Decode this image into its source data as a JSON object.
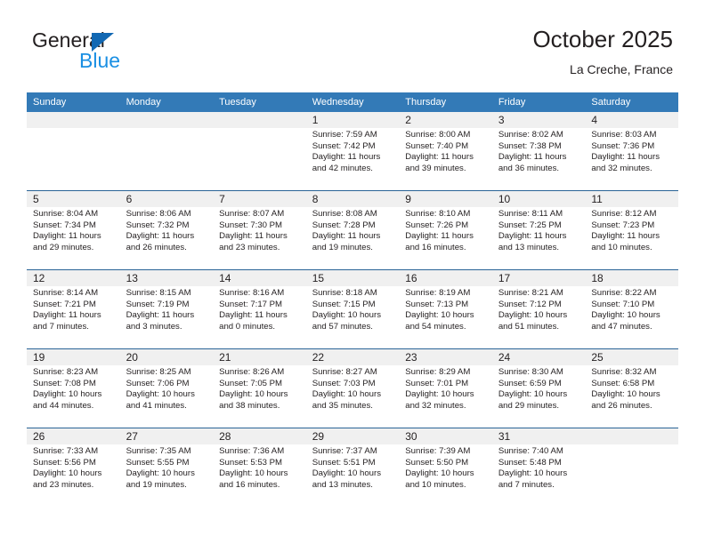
{
  "brand": {
    "name_top": "General",
    "name_bottom": "Blue",
    "accent_color": "#1268b3",
    "blue_text_color": "#1a8fe3"
  },
  "header": {
    "title": "October 2025",
    "subtitle": "La Creche, France"
  },
  "theme": {
    "header_blue": "#337ab7",
    "row_divider_blue": "#2a6496",
    "daynum_band_gray": "#f0f0f0",
    "text_color": "#231f20"
  },
  "weekday_headers": [
    "Sunday",
    "Monday",
    "Tuesday",
    "Wednesday",
    "Thursday",
    "Friday",
    "Saturday"
  ],
  "labels": {
    "sunrise_prefix": "Sunrise:",
    "sunset_prefix": "Sunset:",
    "daylight_prefix": "Daylight:"
  },
  "weeks": [
    [
      {
        "day": "",
        "sunrise": "",
        "sunset": "",
        "daylight_line1": "",
        "daylight_line2": ""
      },
      {
        "day": "",
        "sunrise": "",
        "sunset": "",
        "daylight_line1": "",
        "daylight_line2": ""
      },
      {
        "day": "",
        "sunrise": "",
        "sunset": "",
        "daylight_line1": "",
        "daylight_line2": ""
      },
      {
        "day": "1",
        "sunrise": "Sunrise: 7:59 AM",
        "sunset": "Sunset: 7:42 PM",
        "daylight_line1": "Daylight: 11 hours",
        "daylight_line2": "and 42 minutes."
      },
      {
        "day": "2",
        "sunrise": "Sunrise: 8:00 AM",
        "sunset": "Sunset: 7:40 PM",
        "daylight_line1": "Daylight: 11 hours",
        "daylight_line2": "and 39 minutes."
      },
      {
        "day": "3",
        "sunrise": "Sunrise: 8:02 AM",
        "sunset": "Sunset: 7:38 PM",
        "daylight_line1": "Daylight: 11 hours",
        "daylight_line2": "and 36 minutes."
      },
      {
        "day": "4",
        "sunrise": "Sunrise: 8:03 AM",
        "sunset": "Sunset: 7:36 PM",
        "daylight_line1": "Daylight: 11 hours",
        "daylight_line2": "and 32 minutes."
      }
    ],
    [
      {
        "day": "5",
        "sunrise": "Sunrise: 8:04 AM",
        "sunset": "Sunset: 7:34 PM",
        "daylight_line1": "Daylight: 11 hours",
        "daylight_line2": "and 29 minutes."
      },
      {
        "day": "6",
        "sunrise": "Sunrise: 8:06 AM",
        "sunset": "Sunset: 7:32 PM",
        "daylight_line1": "Daylight: 11 hours",
        "daylight_line2": "and 26 minutes."
      },
      {
        "day": "7",
        "sunrise": "Sunrise: 8:07 AM",
        "sunset": "Sunset: 7:30 PM",
        "daylight_line1": "Daylight: 11 hours",
        "daylight_line2": "and 23 minutes."
      },
      {
        "day": "8",
        "sunrise": "Sunrise: 8:08 AM",
        "sunset": "Sunset: 7:28 PM",
        "daylight_line1": "Daylight: 11 hours",
        "daylight_line2": "and 19 minutes."
      },
      {
        "day": "9",
        "sunrise": "Sunrise: 8:10 AM",
        "sunset": "Sunset: 7:26 PM",
        "daylight_line1": "Daylight: 11 hours",
        "daylight_line2": "and 16 minutes."
      },
      {
        "day": "10",
        "sunrise": "Sunrise: 8:11 AM",
        "sunset": "Sunset: 7:25 PM",
        "daylight_line1": "Daylight: 11 hours",
        "daylight_line2": "and 13 minutes."
      },
      {
        "day": "11",
        "sunrise": "Sunrise: 8:12 AM",
        "sunset": "Sunset: 7:23 PM",
        "daylight_line1": "Daylight: 11 hours",
        "daylight_line2": "and 10 minutes."
      }
    ],
    [
      {
        "day": "12",
        "sunrise": "Sunrise: 8:14 AM",
        "sunset": "Sunset: 7:21 PM",
        "daylight_line1": "Daylight: 11 hours",
        "daylight_line2": "and 7 minutes."
      },
      {
        "day": "13",
        "sunrise": "Sunrise: 8:15 AM",
        "sunset": "Sunset: 7:19 PM",
        "daylight_line1": "Daylight: 11 hours",
        "daylight_line2": "and 3 minutes."
      },
      {
        "day": "14",
        "sunrise": "Sunrise: 8:16 AM",
        "sunset": "Sunset: 7:17 PM",
        "daylight_line1": "Daylight: 11 hours",
        "daylight_line2": "and 0 minutes."
      },
      {
        "day": "15",
        "sunrise": "Sunrise: 8:18 AM",
        "sunset": "Sunset: 7:15 PM",
        "daylight_line1": "Daylight: 10 hours",
        "daylight_line2": "and 57 minutes."
      },
      {
        "day": "16",
        "sunrise": "Sunrise: 8:19 AM",
        "sunset": "Sunset: 7:13 PM",
        "daylight_line1": "Daylight: 10 hours",
        "daylight_line2": "and 54 minutes."
      },
      {
        "day": "17",
        "sunrise": "Sunrise: 8:21 AM",
        "sunset": "Sunset: 7:12 PM",
        "daylight_line1": "Daylight: 10 hours",
        "daylight_line2": "and 51 minutes."
      },
      {
        "day": "18",
        "sunrise": "Sunrise: 8:22 AM",
        "sunset": "Sunset: 7:10 PM",
        "daylight_line1": "Daylight: 10 hours",
        "daylight_line2": "and 47 minutes."
      }
    ],
    [
      {
        "day": "19",
        "sunrise": "Sunrise: 8:23 AM",
        "sunset": "Sunset: 7:08 PM",
        "daylight_line1": "Daylight: 10 hours",
        "daylight_line2": "and 44 minutes."
      },
      {
        "day": "20",
        "sunrise": "Sunrise: 8:25 AM",
        "sunset": "Sunset: 7:06 PM",
        "daylight_line1": "Daylight: 10 hours",
        "daylight_line2": "and 41 minutes."
      },
      {
        "day": "21",
        "sunrise": "Sunrise: 8:26 AM",
        "sunset": "Sunset: 7:05 PM",
        "daylight_line1": "Daylight: 10 hours",
        "daylight_line2": "and 38 minutes."
      },
      {
        "day": "22",
        "sunrise": "Sunrise: 8:27 AM",
        "sunset": "Sunset: 7:03 PM",
        "daylight_line1": "Daylight: 10 hours",
        "daylight_line2": "and 35 minutes."
      },
      {
        "day": "23",
        "sunrise": "Sunrise: 8:29 AM",
        "sunset": "Sunset: 7:01 PM",
        "daylight_line1": "Daylight: 10 hours",
        "daylight_line2": "and 32 minutes."
      },
      {
        "day": "24",
        "sunrise": "Sunrise: 8:30 AM",
        "sunset": "Sunset: 6:59 PM",
        "daylight_line1": "Daylight: 10 hours",
        "daylight_line2": "and 29 minutes."
      },
      {
        "day": "25",
        "sunrise": "Sunrise: 8:32 AM",
        "sunset": "Sunset: 6:58 PM",
        "daylight_line1": "Daylight: 10 hours",
        "daylight_line2": "and 26 minutes."
      }
    ],
    [
      {
        "day": "26",
        "sunrise": "Sunrise: 7:33 AM",
        "sunset": "Sunset: 5:56 PM",
        "daylight_line1": "Daylight: 10 hours",
        "daylight_line2": "and 23 minutes."
      },
      {
        "day": "27",
        "sunrise": "Sunrise: 7:35 AM",
        "sunset": "Sunset: 5:55 PM",
        "daylight_line1": "Daylight: 10 hours",
        "daylight_line2": "and 19 minutes."
      },
      {
        "day": "28",
        "sunrise": "Sunrise: 7:36 AM",
        "sunset": "Sunset: 5:53 PM",
        "daylight_line1": "Daylight: 10 hours",
        "daylight_line2": "and 16 minutes."
      },
      {
        "day": "29",
        "sunrise": "Sunrise: 7:37 AM",
        "sunset": "Sunset: 5:51 PM",
        "daylight_line1": "Daylight: 10 hours",
        "daylight_line2": "and 13 minutes."
      },
      {
        "day": "30",
        "sunrise": "Sunrise: 7:39 AM",
        "sunset": "Sunset: 5:50 PM",
        "daylight_line1": "Daylight: 10 hours",
        "daylight_line2": "and 10 minutes."
      },
      {
        "day": "31",
        "sunrise": "Sunrise: 7:40 AM",
        "sunset": "Sunset: 5:48 PM",
        "daylight_line1": "Daylight: 10 hours",
        "daylight_line2": "and 7 minutes."
      },
      {
        "day": "",
        "sunrise": "",
        "sunset": "",
        "daylight_line1": "",
        "daylight_line2": ""
      }
    ]
  ]
}
